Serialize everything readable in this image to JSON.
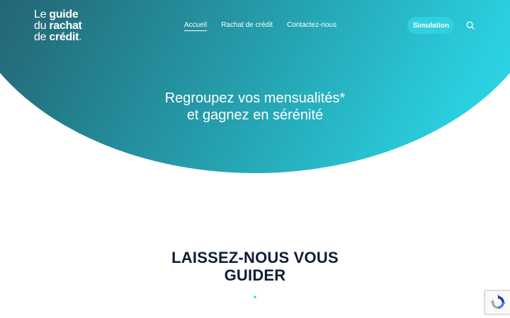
{
  "logo": {
    "line1_light": "Le ",
    "line1_bold": "guide",
    "line2_light": "du ",
    "line2_bold": "rachat",
    "line3_light": "de ",
    "line3_bold": "crédit",
    "dot": "."
  },
  "nav": {
    "items": [
      {
        "label": "Accueil",
        "active": true
      },
      {
        "label": "Rachat de crédit",
        "active": false
      },
      {
        "label": "Contactez-nous",
        "active": false
      }
    ]
  },
  "header": {
    "simulation_label": "Simulation"
  },
  "hero": {
    "line1": "Regroupez vos mensualités*",
    "line2": "et gagnez en sérénité"
  },
  "section": {
    "title_line1": "LAISSEZ-NOUS VOUS",
    "title_line2": "GUIDER",
    "title_dot": "."
  },
  "colors": {
    "accent": "#31dbe9",
    "gradient_dark": "#1f4a5e",
    "gradient_light": "#31dbe9",
    "title_text": "#0e1d33"
  },
  "icons": {
    "search": "search-icon",
    "recaptcha": "recaptcha-icon"
  }
}
